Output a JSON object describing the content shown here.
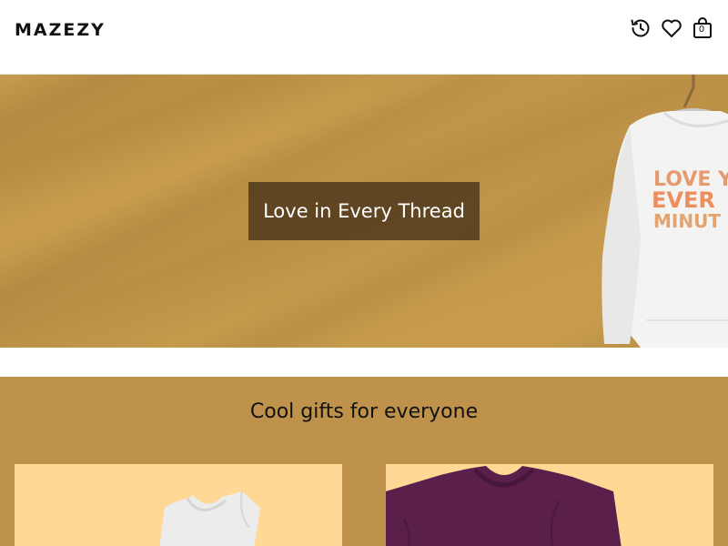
{
  "header": {
    "logo": "MAZEZY",
    "icons": {
      "history": "history-icon",
      "wishlist": "heart-icon",
      "cart": "shopping-bag-icon"
    },
    "cart_count": "0"
  },
  "hero": {
    "title": "Love in Every Thread",
    "background_color": "#c69a4b",
    "product_print": {
      "line1": "LOVE YO",
      "line2": "EVER",
      "line3": "MINUT"
    }
  },
  "collection": {
    "title": "Cool gifts for everyone",
    "background_color": "#bf924b",
    "card_background": "#fed894",
    "cards": [
      {
        "product": "white-tank-top"
      },
      {
        "product": "purple-tshirt"
      }
    ]
  }
}
